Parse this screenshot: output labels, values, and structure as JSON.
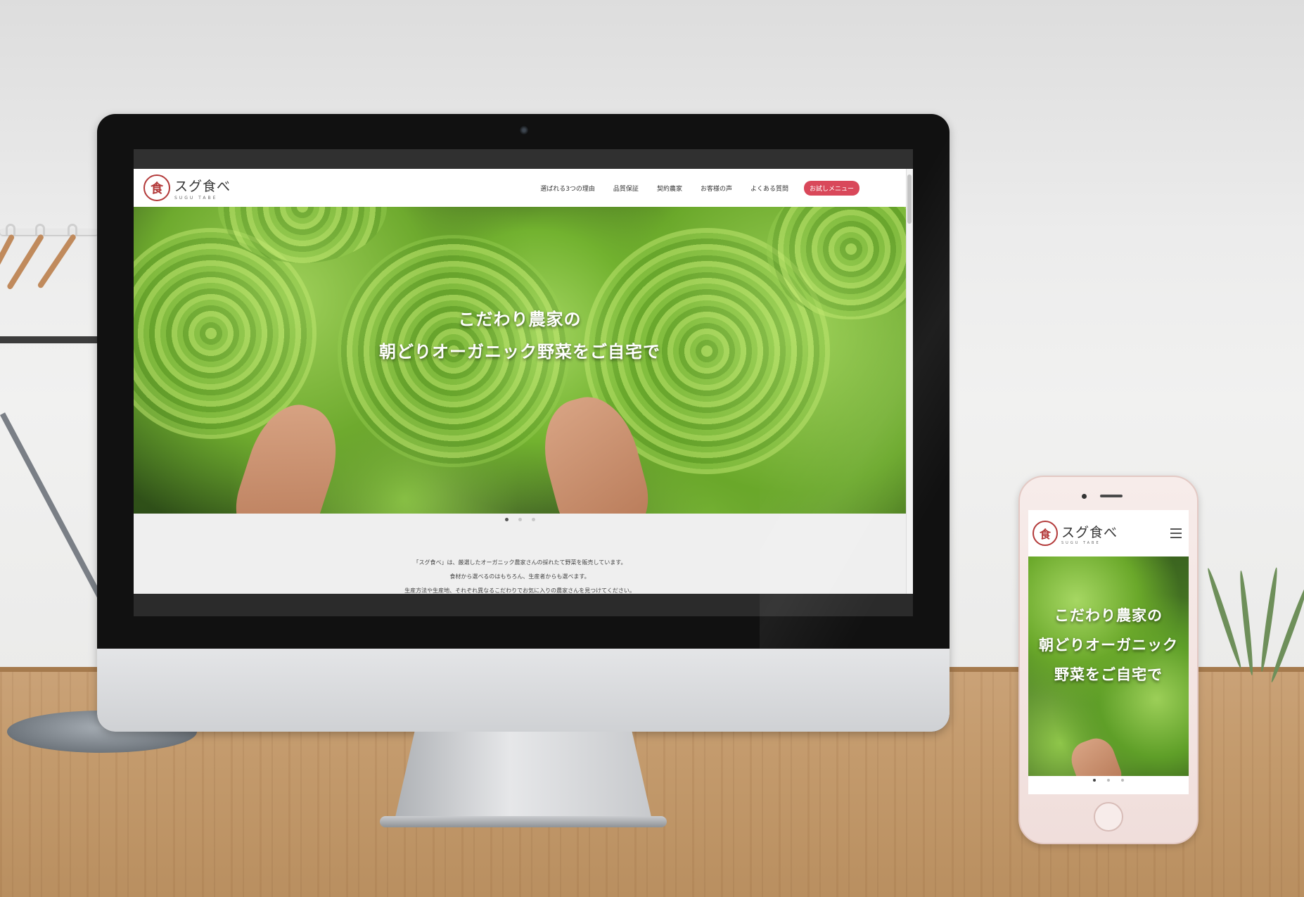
{
  "desktop_site": {
    "logo": {
      "seal": "食",
      "name": "スグ食べ",
      "sub": "SUGU TABE"
    },
    "nav": {
      "items": [
        "選ばれる3つの理由",
        "品質保証",
        "契約農家",
        "お客様の声",
        "よくある質問"
      ],
      "cta": "お試しメニュー"
    },
    "hero": {
      "line1": "こだわり農家の",
      "line2": "朝どりオーガニック野菜をご自宅で"
    },
    "slider": {
      "count": 3,
      "active_index": 0
    },
    "intro": {
      "lines": [
        "「スグ食べ」は、厳選したオーガニック農家さんの採れたて野菜を販売しています。",
        "食材から選べるのはもちろん、生産者からも選べます。",
        "生産方法や生産地、それぞれ異なるこだわりでお気に入りの農家さんを見つけてください。"
      ]
    }
  },
  "mobile_site": {
    "logo": {
      "seal": "食",
      "name": "スグ食べ",
      "sub": "SUGU TABE"
    },
    "menu_icon": "hamburger-icon",
    "hero": {
      "line1": "こだわり農家の",
      "line2": "朝どりオーガニック",
      "line3": "野菜をご自宅で"
    },
    "slider": {
      "count": 3,
      "active_index": 0
    }
  },
  "colors": {
    "brand_red": "#b33a3a",
    "cta_pink": "#d9485a",
    "hero_green": "#72b22f"
  }
}
